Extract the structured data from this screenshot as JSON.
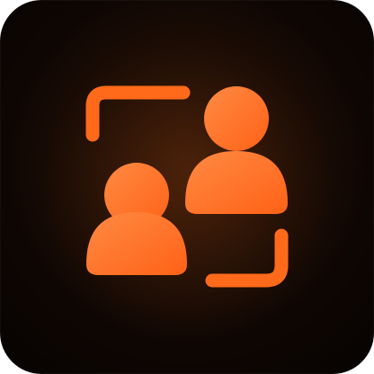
{
  "app_icon": {
    "icon_name": "switch-user-icon",
    "colors": {
      "background_center": "#3a1a08",
      "background_edge": "#060302",
      "accent": "#ff6a1a",
      "accent_light": "#ff8a44"
    }
  }
}
